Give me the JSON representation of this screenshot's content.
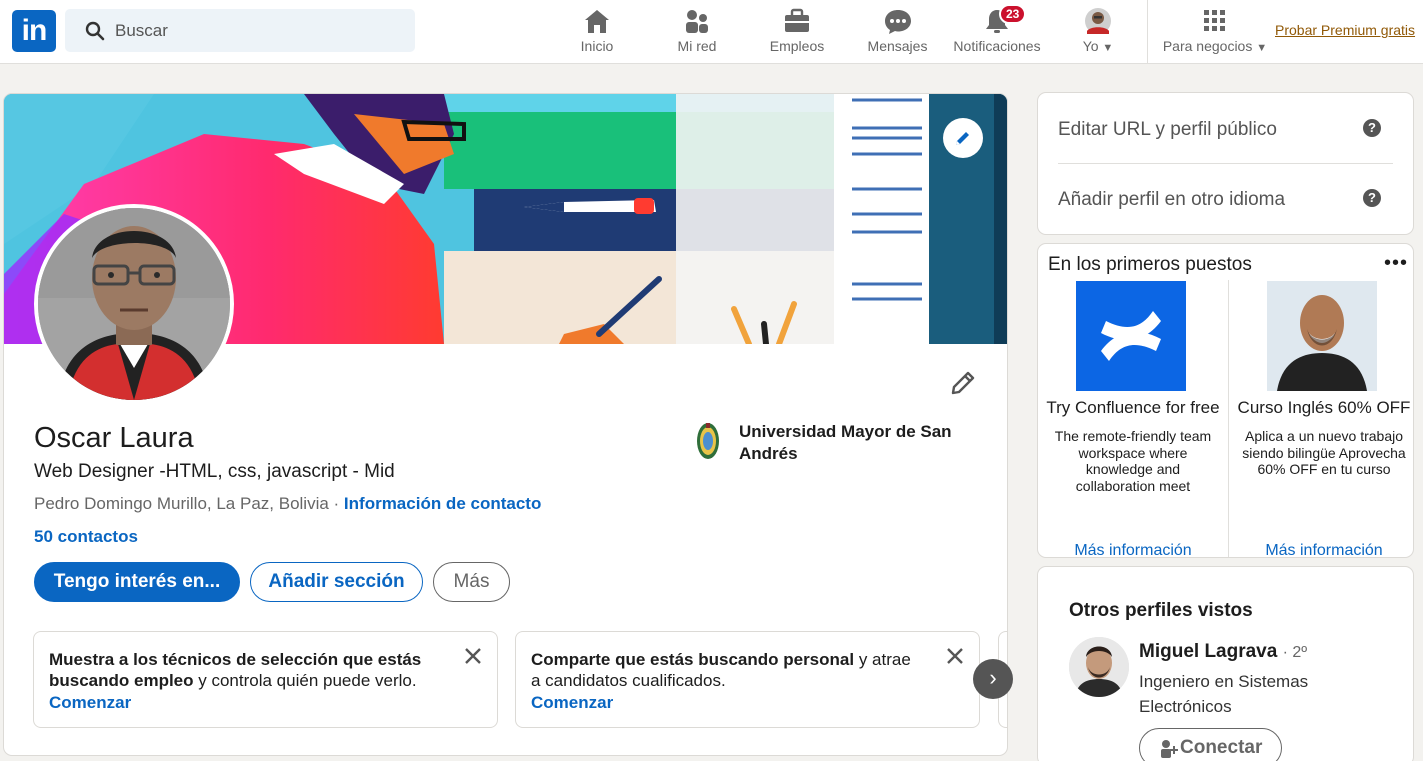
{
  "nav": {
    "search_placeholder": "Buscar",
    "items": [
      {
        "label": "Inicio",
        "icon": "home-icon"
      },
      {
        "label": "Mi red",
        "icon": "network-icon"
      },
      {
        "label": "Empleos",
        "icon": "briefcase-icon"
      },
      {
        "label": "Mensajes",
        "icon": "messaging-icon"
      },
      {
        "label": "Notificaciones",
        "icon": "bell-icon",
        "badge": "23"
      },
      {
        "label": "Yo",
        "icon": "avatar"
      },
      {
        "label": "Para negocios",
        "icon": "grid-icon"
      }
    ],
    "premium": "Probar Premium gratis"
  },
  "profile": {
    "name": "Oscar Laura",
    "headline": "Web Designer -HTML, css, javascript - Mid",
    "location": "Pedro Domingo Murillo, La Paz, Bolivia",
    "separator": " · ",
    "contact_info": "Información de contacto",
    "contacts": "50 contactos",
    "education": "Universidad Mayor de San Andrés",
    "buttons": {
      "primary": "Tengo interés en...",
      "secondary": "Añadir sección",
      "more": "Más"
    }
  },
  "tips": [
    {
      "bold": "Muestra a los técnicos de selección que estás buscando empleo",
      "rest": " y controla quién puede verlo.",
      "action": "Comenzar"
    },
    {
      "bold": "Comparte que estás buscando personal",
      "rest": " y atrae a candidatos cualificados.",
      "action": "Comenzar"
    }
  ],
  "sidebar": {
    "edit_url": "Editar URL y perfil público",
    "add_language": "Añadir perfil en otro idioma",
    "help_glyph": "?",
    "promoted_title": "En los primeros puestos",
    "ads": [
      {
        "title": "Try Confluence for free",
        "desc": "The remote-friendly team workspace where knowledge and collaboration meet",
        "more": "Más información"
      },
      {
        "title": "Curso Inglés 60% OFF",
        "desc": "Aplica a un nuevo trabajo siendo bilingüe Aprovecha 60% OFF en tu curso",
        "more": "Más información"
      }
    ],
    "others_title": "Otros perfiles vistos",
    "others": [
      {
        "name": "Miguel Lagrava",
        "degree": "· 2º",
        "desc": "Ingeniero en Sistemas Electrónicos",
        "action": "Conectar"
      }
    ]
  },
  "colors": {
    "brand": "#0a66c2",
    "badge": "#cb112d",
    "premium": "#915907",
    "page_bg": "#f3f2ef"
  }
}
